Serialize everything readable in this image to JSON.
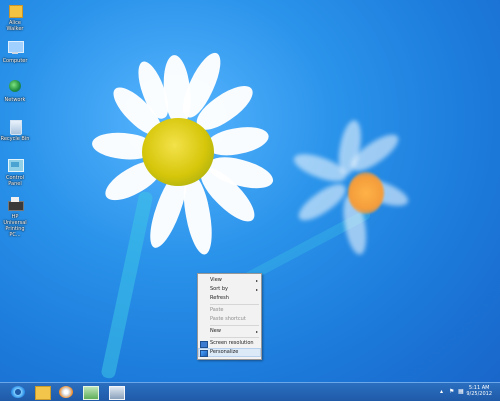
{
  "desktop": {
    "icons": [
      {
        "label": "Alice Walker",
        "icon": "folder-icon"
      },
      {
        "label": "Computer",
        "icon": "computer-icon"
      },
      {
        "label": "Network",
        "icon": "network-icon"
      },
      {
        "label": "Recycle Bin",
        "icon": "recycle-bin-icon"
      },
      {
        "label": "Control Panel",
        "icon": "control-panel-icon"
      },
      {
        "label": "HP Universal Printing PC...",
        "icon": "printer-icon"
      }
    ]
  },
  "context_menu": {
    "items": {
      "view": "View",
      "sort_by": "Sort by",
      "refresh": "Refresh",
      "paste": "Paste",
      "paste_shortcut": "Paste shortcut",
      "new": "New",
      "screen_resolution": "Screen resolution",
      "personalize": "Personalize"
    },
    "submenu_arrow": "▸"
  },
  "taskbar": {
    "apps": [
      {
        "name": "Internet Explorer",
        "icon": "internet-explorer-icon"
      },
      {
        "name": "File Explorer",
        "icon": "file-explorer-icon"
      },
      {
        "name": "Media Player",
        "icon": "media-player-icon"
      },
      {
        "name": "App",
        "icon": "app-icon"
      },
      {
        "name": "Remote Desktop",
        "icon": "remote-desktop-icon"
      }
    ],
    "clock": {
      "time": "5:11 AM",
      "date": "9/25/2012"
    }
  },
  "colors": {
    "wallpaper": "#1f7fe0",
    "taskbar": "#2563b3",
    "menu_bg": "#f2f2f2",
    "highlight": "#dce9f7",
    "daisy_center": "#d6c60a"
  }
}
